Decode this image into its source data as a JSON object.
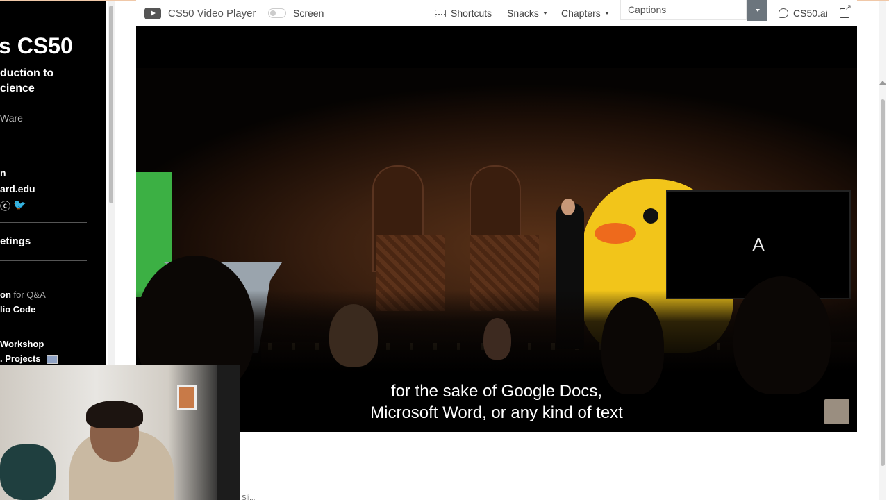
{
  "sidebar": {
    "title": "s CS50",
    "subtitle_lines": [
      "duction to",
      "cience"
    ],
    "author": "Ware",
    "contact_lines": [
      "n",
      "ard.edu"
    ],
    "social_icons": [
      "threads-icon",
      "twitter-icon"
    ],
    "meetings": "etings",
    "qa_line_bold": "on",
    "qa_line_muted": "for Q&A",
    "vscode_line": "lio Code",
    "workshop": "Workshop",
    "projects": ". Projects"
  },
  "toolbar": {
    "player_title": "CS50 Video Player",
    "screen_label": "Screen",
    "shortcuts_label": "Shortcuts",
    "snacks_label": "Snacks",
    "chapters_label": "Chapters",
    "captions_label": "Captions",
    "cs50ai_label": "CS50.ai"
  },
  "video": {
    "monitor_text": "A",
    "subtitle_line1": "for the sake of Google Docs,",
    "subtitle_line2": "Microsoft Word, or any kind of text"
  },
  "page": {
    "bottom_fragment": "Sli..."
  }
}
